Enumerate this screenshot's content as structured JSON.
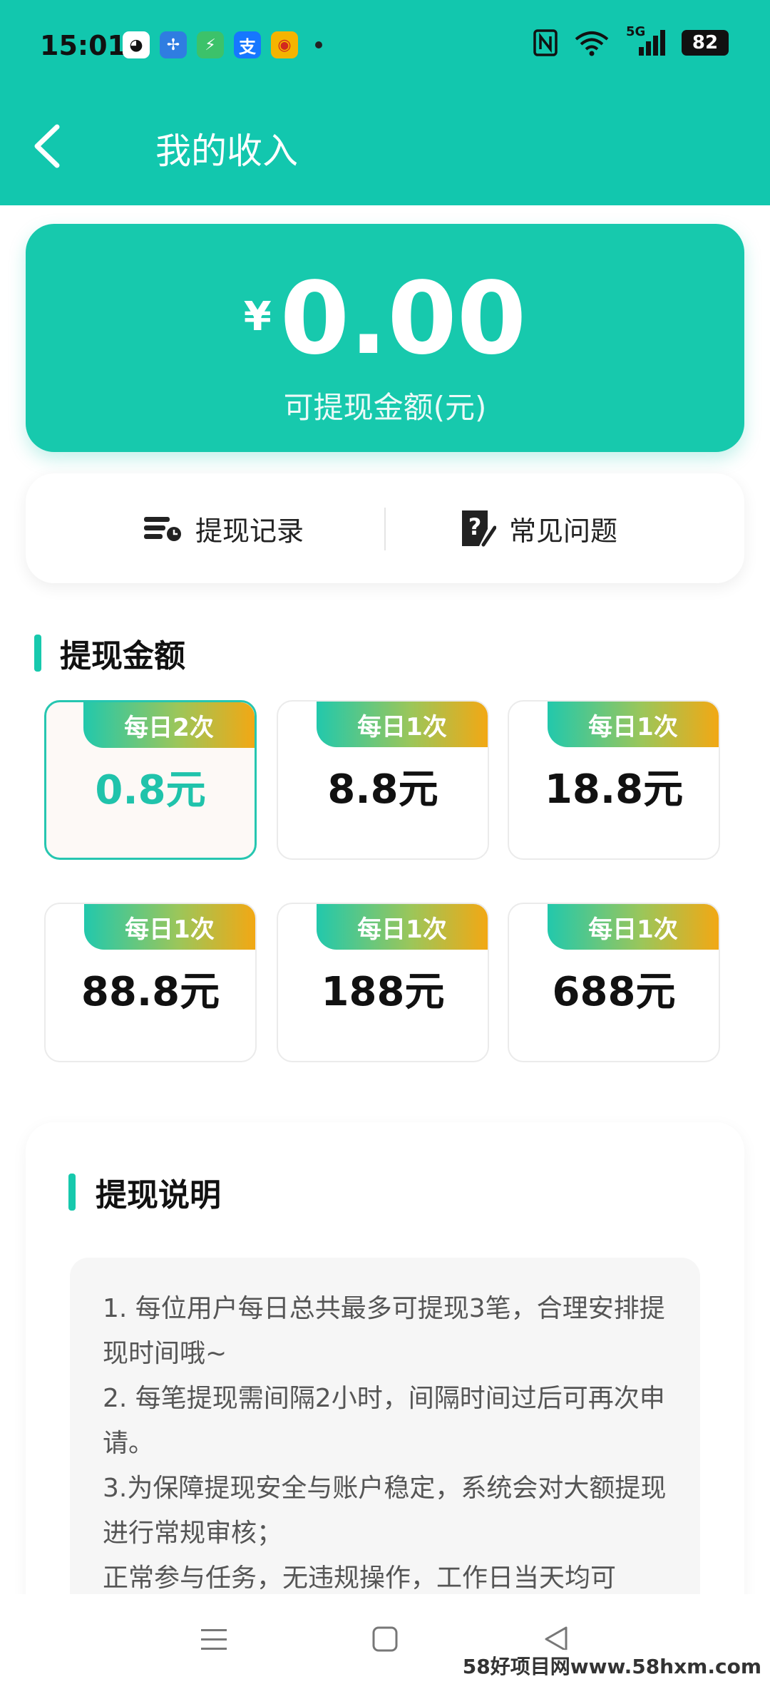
{
  "status_bar": {
    "time": "15:01",
    "app_icons": [
      {
        "name": "qq-icon",
        "glyph": "◕",
        "color": "#ffffff"
      },
      {
        "name": "fan-app-icon",
        "glyph": "✢",
        "color": "#2f7de1"
      },
      {
        "name": "shield-app-icon",
        "glyph": "⚡",
        "color": "#3cc26a"
      },
      {
        "name": "alipay-icon",
        "glyph": "支",
        "color": "#1677ff"
      },
      {
        "name": "weibo-icon",
        "glyph": "◉",
        "color": "#f5b400"
      }
    ],
    "network": "5G",
    "battery": "82"
  },
  "header": {
    "title": "我的收入"
  },
  "balance": {
    "currency": "¥",
    "amount": "0.00",
    "label": "可提现金额(元)"
  },
  "actions": {
    "records_label": "提现记录",
    "faq_label": "常见问题"
  },
  "withdraw_section": {
    "title": "提现金额",
    "tiers": [
      {
        "badge": "每日2次",
        "amount": "0.8元",
        "selected": true
      },
      {
        "badge": "每日1次",
        "amount": "8.8元",
        "selected": false
      },
      {
        "badge": "每日1次",
        "amount": "18.8元",
        "selected": false
      },
      {
        "badge": "每日1次",
        "amount": "88.8元",
        "selected": false
      },
      {
        "badge": "每日1次",
        "amount": "188元",
        "selected": false
      },
      {
        "badge": "每日1次",
        "amount": "688元",
        "selected": false
      }
    ]
  },
  "notes": {
    "title": "提现说明",
    "lines": [
      "1. 每位用户每日总共最多可提现3笔，合理安排提现时间哦~",
      "2. 每笔提现需间隔2小时，间隔时间过后可再次申请。",
      "3.为保障提现安全与账户稳定，系统会对大额提现进行常规审核；",
      "正常参与任务，无违规操作，工作日当天均可"
    ]
  },
  "watermark": "58好项目网www.58hxm.com",
  "colors": {
    "brand": "#12c7ae",
    "badge_end": "#f2a814"
  }
}
